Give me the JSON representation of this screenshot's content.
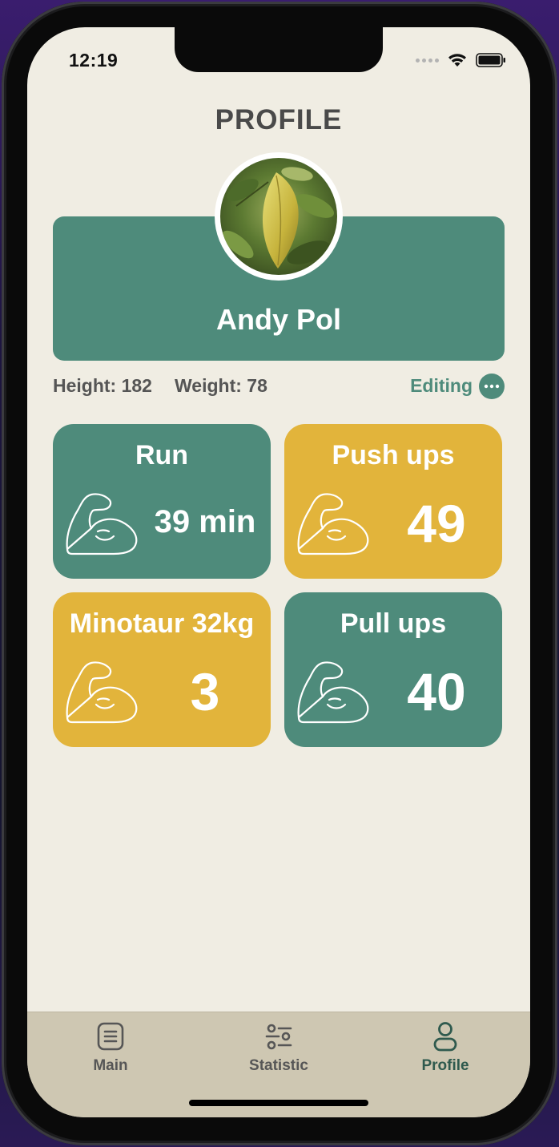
{
  "status_bar": {
    "time": "12:19"
  },
  "page": {
    "title": "PROFILE"
  },
  "profile": {
    "name": "Andy Pol",
    "height_text": "Height: 182",
    "weight_text": "Weight: 78",
    "editing_label": "Editing"
  },
  "exercise_cards": [
    {
      "title": "Run",
      "value": "39 min",
      "color": "#4e8b7b",
      "icon": "flexed-biceps-icon"
    },
    {
      "title": "Push ups",
      "value": "49",
      "color": "#e2b43b",
      "icon": "flexed-biceps-icon"
    },
    {
      "title": "Minotaur 32kg",
      "value": "3",
      "color": "#e2b43b",
      "icon": "flexed-biceps-icon"
    },
    {
      "title": "Pull ups",
      "value": "40",
      "color": "#4e8b7b",
      "icon": "flexed-biceps-icon"
    }
  ],
  "tab_bar": {
    "tabs": [
      {
        "label": "Main",
        "icon": "document-list-icon",
        "active": false
      },
      {
        "label": "Statistic",
        "icon": "sliders-icon",
        "active": false
      },
      {
        "label": "Profile",
        "icon": "person-icon",
        "active": true
      }
    ]
  },
  "colors": {
    "background": "#f0ede3",
    "accent_green": "#4e8b7b",
    "accent_yellow": "#e2b43b",
    "tab_bar": "#cec7b2"
  }
}
